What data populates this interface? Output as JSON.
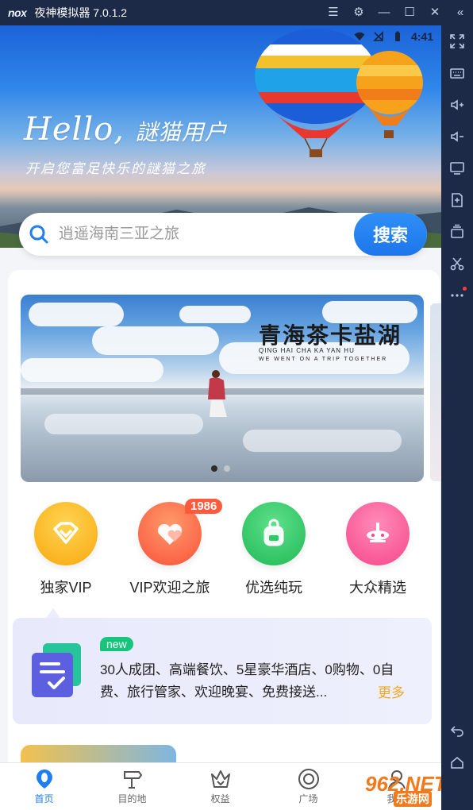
{
  "emulator": {
    "logo": "nox",
    "title": "夜神模拟器 7.0.1.2",
    "controls": [
      "menu-icon",
      "gear-icon",
      "minimize-icon",
      "maximize-icon",
      "close-icon",
      "collapse-icon"
    ],
    "toolbar": [
      "fullscreen-icon",
      "keyboard-icon",
      "volume-up-icon",
      "volume-down-icon",
      "screen-icon",
      "apk-install-icon",
      "multi-instance-icon",
      "scissors-icon",
      "more-icon"
    ],
    "nav_buttons": [
      "back-icon",
      "home-icon"
    ]
  },
  "status_bar": {
    "time": "4:41"
  },
  "hero": {
    "greeting": "Hello,",
    "greeting_user": "謎猫用户",
    "tagline": "开启您富足快乐的謎猫之旅"
  },
  "search": {
    "placeholder": "逍遥海南三亚之旅",
    "button": "搜索"
  },
  "banner": {
    "title": "青海茶卡盐湖",
    "subtitle": "QING HAI CHA KA YAN HU",
    "subtitle2": "WE WENT ON A TRIP TOGETHER",
    "pages": 2,
    "current_page": 1
  },
  "categories": [
    {
      "label": "独家VIP",
      "icon": "vip-diamond-icon",
      "color": "#fbb41e"
    },
    {
      "label": "VIP欢迎之旅",
      "icon": "hearts-icon",
      "color": "#fb6a4a",
      "badge": "1986"
    },
    {
      "label": "优选纯玩",
      "icon": "backpack-icon",
      "color": "#2fca66"
    },
    {
      "label": "大众精选",
      "icon": "airplane-icon",
      "color": "#fb5a95"
    }
  ],
  "vip_card": {
    "tag": "new",
    "text": "30人成团、高端餐饮、5星豪华酒店、0购物、0自费、旅行管家、欢迎晚宴、免费接送...",
    "more": "更多"
  },
  "tabbar": [
    {
      "label": "首页",
      "icon": "home-pin-icon",
      "active": true
    },
    {
      "label": "目的地",
      "icon": "signpost-icon",
      "active": false
    },
    {
      "label": "权益",
      "icon": "crown-icon",
      "active": false
    },
    {
      "label": "广场",
      "icon": "target-icon",
      "active": false
    },
    {
      "label": "我的",
      "icon": "profile-icon",
      "active": false
    }
  ],
  "watermark": {
    "line1": "962.NET",
    "line2": "乐游网"
  },
  "colors": {
    "accent": "#1f7ef0",
    "more": "#f5a623",
    "new_tag": "#18c47c"
  }
}
